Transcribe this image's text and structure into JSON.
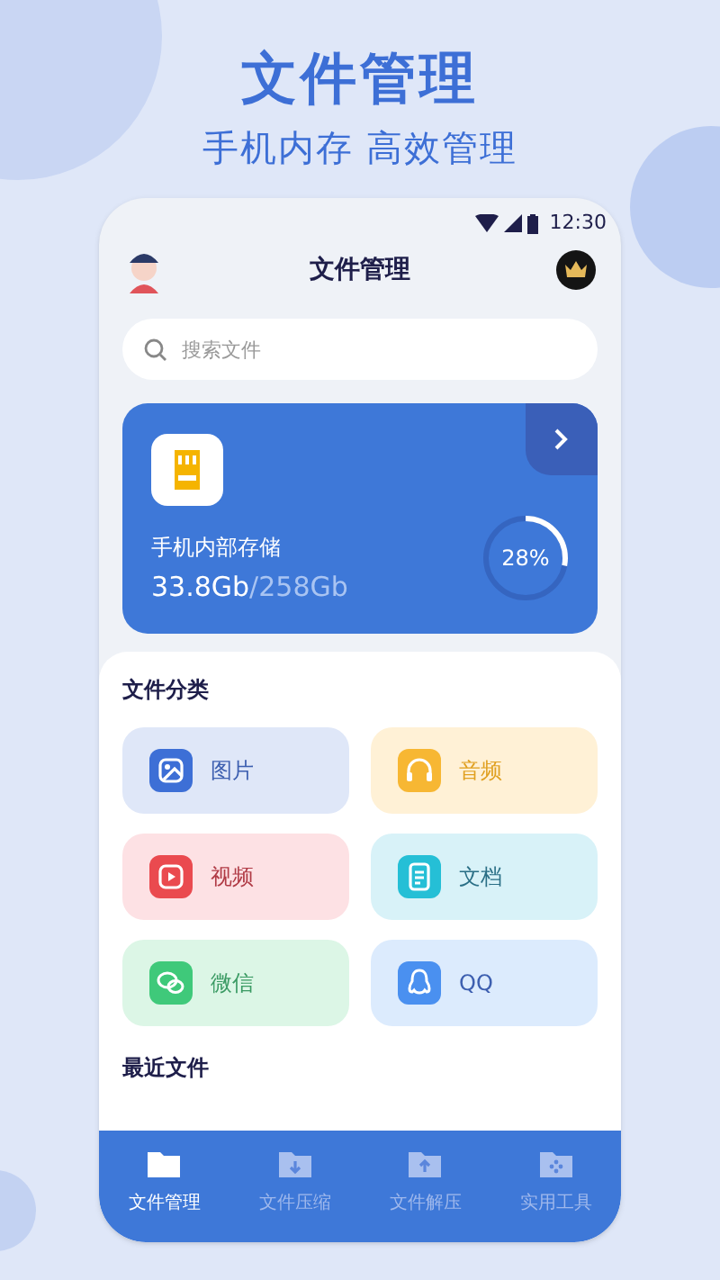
{
  "headline": "文件管理",
  "subheadline": "手机内存 高效管理",
  "status_bar": {
    "time": "12:30"
  },
  "header": {
    "title": "文件管理"
  },
  "search": {
    "placeholder": "搜索文件"
  },
  "storage": {
    "name": "手机内部存储",
    "used": "33.8Gb",
    "total": "/258Gb",
    "percent": "28%",
    "level": 0.28
  },
  "categories_title": "文件分类",
  "categories": [
    {
      "label": "图片",
      "kind": "image",
      "color": "#3d6fd6"
    },
    {
      "label": "音频",
      "kind": "audio",
      "color": "#f7b733"
    },
    {
      "label": "视频",
      "kind": "video",
      "color": "#ea4a4f"
    },
    {
      "label": "文档",
      "kind": "doc",
      "color": "#25bfd6"
    },
    {
      "label": "微信",
      "kind": "wechat",
      "color": "#3fc97a"
    },
    {
      "label": "QQ",
      "kind": "qq",
      "color": "#4a90f0"
    }
  ],
  "recent_title": "最近文件",
  "nav": [
    {
      "label": "文件管理",
      "kind": "folder",
      "selected": true
    },
    {
      "label": "文件压缩",
      "kind": "down",
      "selected": false
    },
    {
      "label": "文件解压",
      "kind": "up",
      "selected": false
    },
    {
      "label": "实用工具",
      "kind": "tools",
      "selected": false
    }
  ]
}
